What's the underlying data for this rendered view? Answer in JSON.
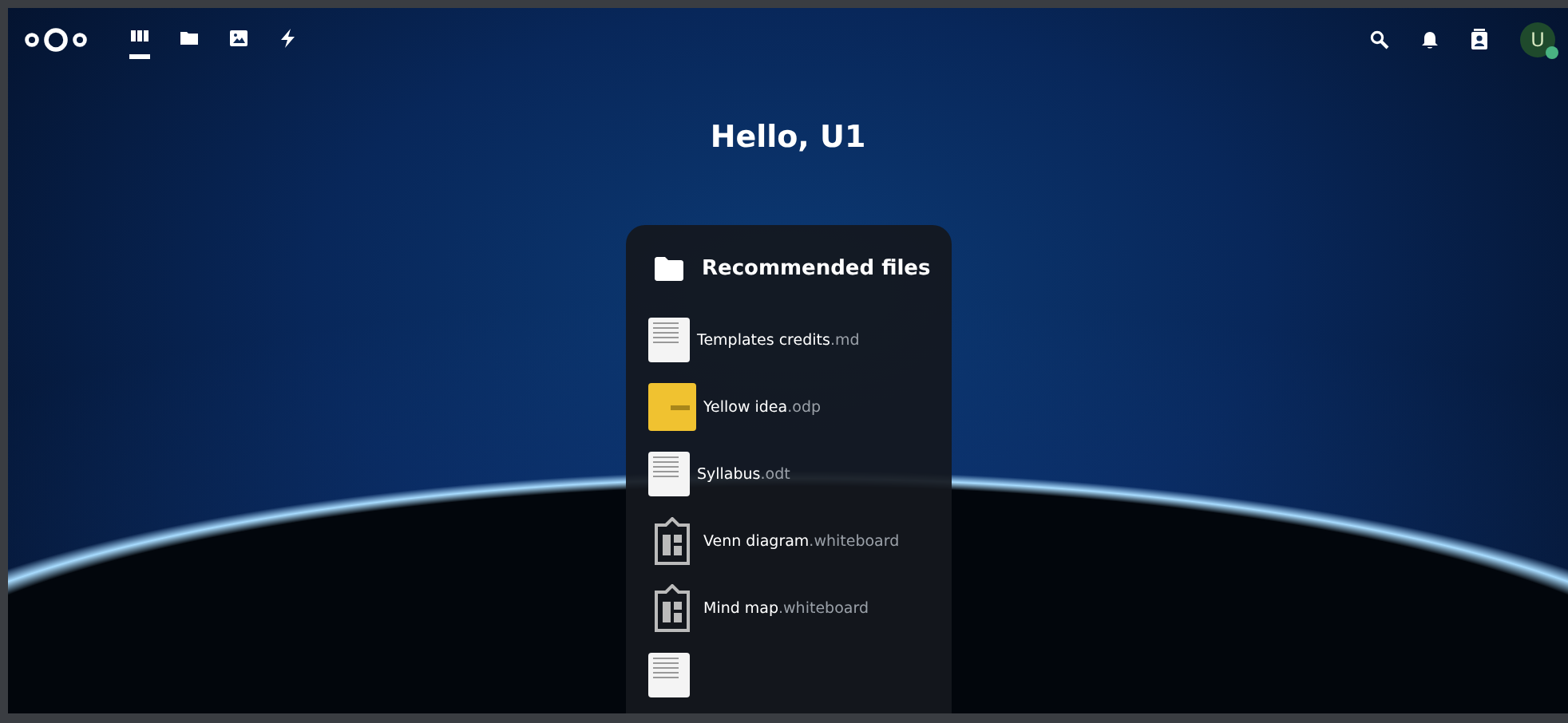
{
  "header": {
    "apps": [
      {
        "kind": "dashboard",
        "selected": true
      },
      {
        "kind": "files",
        "selected": false
      },
      {
        "kind": "photos",
        "selected": false
      },
      {
        "kind": "activity",
        "selected": false
      }
    ],
    "avatar": {
      "initial": "U",
      "online": true
    }
  },
  "greeting": "Hello, U1",
  "recommended": {
    "title": "Recommended files",
    "files": [
      {
        "kind": "document",
        "name": "Templates credits",
        "extension": ".md"
      },
      {
        "kind": "presentation",
        "name": "Yellow idea",
        "extension": ".odp"
      },
      {
        "kind": "document",
        "name": "Syllabus",
        "extension": ".odt"
      },
      {
        "kind": "whiteboard",
        "name": "Venn diagram",
        "extension": ".whiteboard"
      },
      {
        "kind": "whiteboard",
        "name": "Mind map",
        "extension": ".whiteboard"
      },
      {
        "kind": "document"
      }
    ]
  }
}
